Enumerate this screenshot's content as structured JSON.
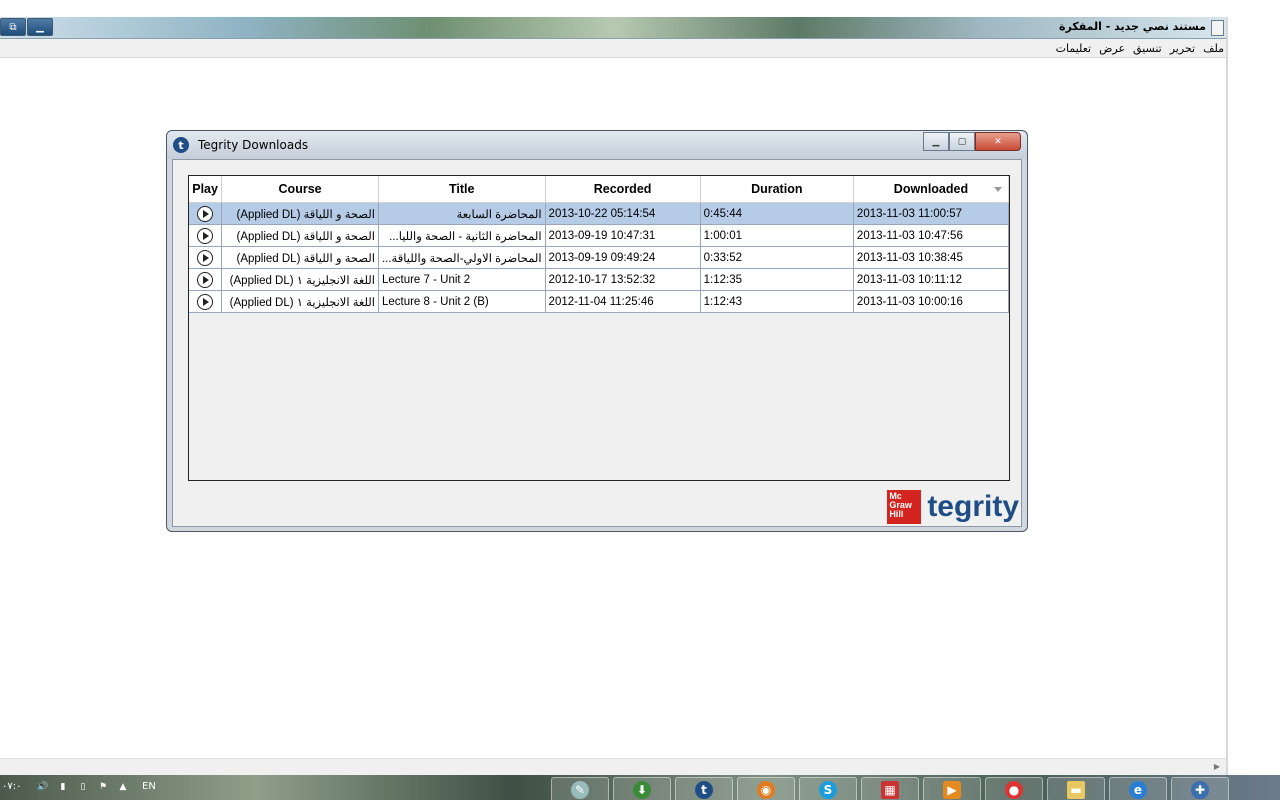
{
  "notepad": {
    "title": "مستند نصي جديد - المفكرة",
    "menu": [
      "ملف",
      "تحرير",
      "تنسيق",
      "عرض",
      "تعليمات"
    ]
  },
  "tegrity": {
    "title": "Tegrity Downloads",
    "columns": [
      "Play",
      "Course",
      "Title",
      "Recorded",
      "Duration",
      "Downloaded"
    ],
    "rows": [
      {
        "course": "(Applied DL) الصحة و اللياقة",
        "title": "المحاضرة السابعة",
        "recorded": "2013-10-22 05:14:54",
        "duration": "0:45:44",
        "downloaded": "2013-11-03 11:00:57"
      },
      {
        "course": "(Applied DL) الصحة و اللياقة",
        "title": "المحاضرة الثانية - الصحة والليا...",
        "recorded": "2013-09-19 10:47:31",
        "duration": "1:00:01",
        "downloaded": "2013-11-03 10:47:56"
      },
      {
        "course": "(Applied DL) الصحة و اللياقة",
        "title": "المحاضرة الاولي-الصحة واللياقة...",
        "recorded": "2013-09-19 09:49:24",
        "duration": "0:33:52",
        "downloaded": "2013-11-03 10:38:45"
      },
      {
        "course": "(Applied DL) اللغة الانجليزية ١",
        "title": "Lecture 7 - Unit 2",
        "recorded": "2012-10-17 13:52:32",
        "duration": "1:12:35",
        "downloaded": "2013-11-03 10:11:12"
      },
      {
        "course": "(Applied DL) اللغة الانجليزية ١",
        "title": "Lecture 8 - Unit 2 (B)",
        "recorded": "2012-11-04 11:25:46",
        "duration": "1:12:43",
        "downloaded": "2013-11-03 10:00:16"
      }
    ],
    "brand_mcgraw": "Mc Graw Hill",
    "brand_tegrity": "tegrity"
  },
  "taskbar": {
    "clock": "٠٧:٠",
    "lang": "EN",
    "apps": [
      "pencil-app-icon",
      "internet-download-manager-icon",
      "tegrity-app-icon",
      "firefox-icon",
      "skype-icon",
      "grid-app-icon",
      "media-player-icon",
      "chrome-icon",
      "folder-icon",
      "ie-icon",
      "start-orb-icon"
    ]
  }
}
